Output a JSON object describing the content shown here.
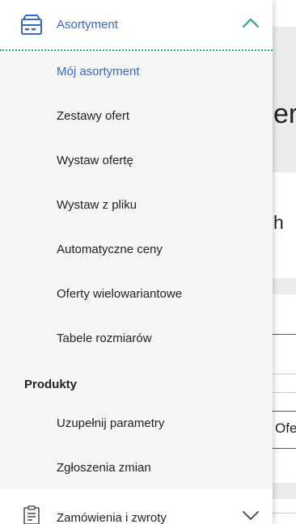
{
  "colors": {
    "accent": "#3a66c3",
    "teal": "#2aa391",
    "submenu_bg": "#f5f6f6",
    "background_band": "#ececec"
  },
  "background_page": {
    "title_fragment": "er",
    "subtitle_fragment": "h",
    "cell_fragment": "Ofe"
  },
  "menu": {
    "section_assortment": {
      "label": "Asortyment",
      "icon": "box-icon",
      "chevron": "chevron-up-icon"
    },
    "assortment_items": [
      {
        "label": "Mój asortyment",
        "active": true
      },
      {
        "label": "Zestawy ofert"
      },
      {
        "label": "Wystaw ofertę"
      },
      {
        "label": "Wystaw z pliku"
      },
      {
        "label": "Automatyczne ceny"
      },
      {
        "label": "Oferty wielowariantowe"
      },
      {
        "label": "Tabele rozmiarów"
      }
    ],
    "group_products": {
      "label": "Produkty",
      "items": [
        {
          "label": "Uzupełnij parametry"
        },
        {
          "label": "Zgłoszenia zmian"
        }
      ]
    },
    "section_orders": {
      "label": "Zamówienia i zwroty",
      "icon": "clipboard-icon",
      "chevron": "chevron-down-icon"
    }
  }
}
